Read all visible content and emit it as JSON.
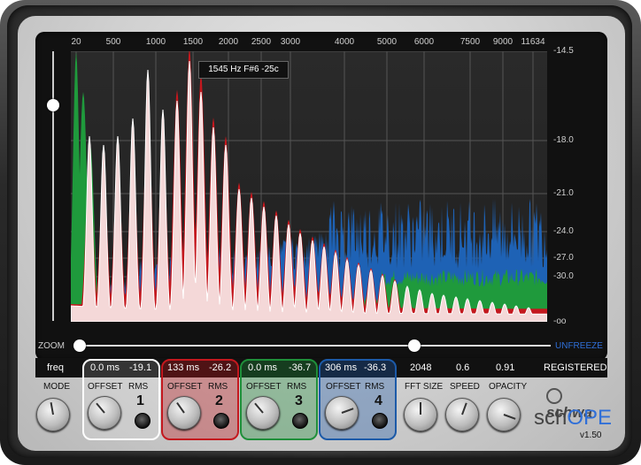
{
  "freq_labels": [
    "20",
    "500",
    "1000",
    "1500",
    "2000",
    "2500",
    "3000",
    "4000",
    "5000",
    "6000",
    "7500",
    "9000",
    "11634"
  ],
  "db_labels": [
    "-14.5",
    "-18.0",
    "-21.0",
    "-24.0",
    "-27.0",
    "-30.0",
    "-oo"
  ],
  "tooltip": "1545 Hz F#6 -25c",
  "zoom_label": "ZOOM",
  "unfreeze_label": "UNFREEZE",
  "readout": {
    "mode": "freq",
    "ch1_offset": "0.0 ms",
    "ch1_rms": "-19.1",
    "ch2_offset": "133 ms",
    "ch2_rms": "-26.2",
    "ch3_offset": "0.0 ms",
    "ch3_rms": "-36.7",
    "ch4_offset": "306 ms",
    "ch4_rms": "-36.3",
    "fft_size": "2048",
    "speed": "0.6",
    "opacity": "0.91",
    "registered": "REGISTERED"
  },
  "controls": {
    "mode": "MODE",
    "offset": "OFFSET",
    "rms": "RMS",
    "fft_size": "FFT SIZE",
    "speed": "SPEED",
    "opacity": "OPACITY",
    "ch1": "1",
    "ch2": "2",
    "ch3": "3",
    "ch4": "4"
  },
  "brand": {
    "company": "schwa",
    "product_a": "sch",
    "product_b": "OPE",
    "version": "v1.50"
  },
  "colors": {
    "white": "#f4d8d8",
    "red": "#c4181e",
    "green": "#1f9a3c",
    "blue": "#1e62b5",
    "accent": "#2f6fd8"
  }
}
